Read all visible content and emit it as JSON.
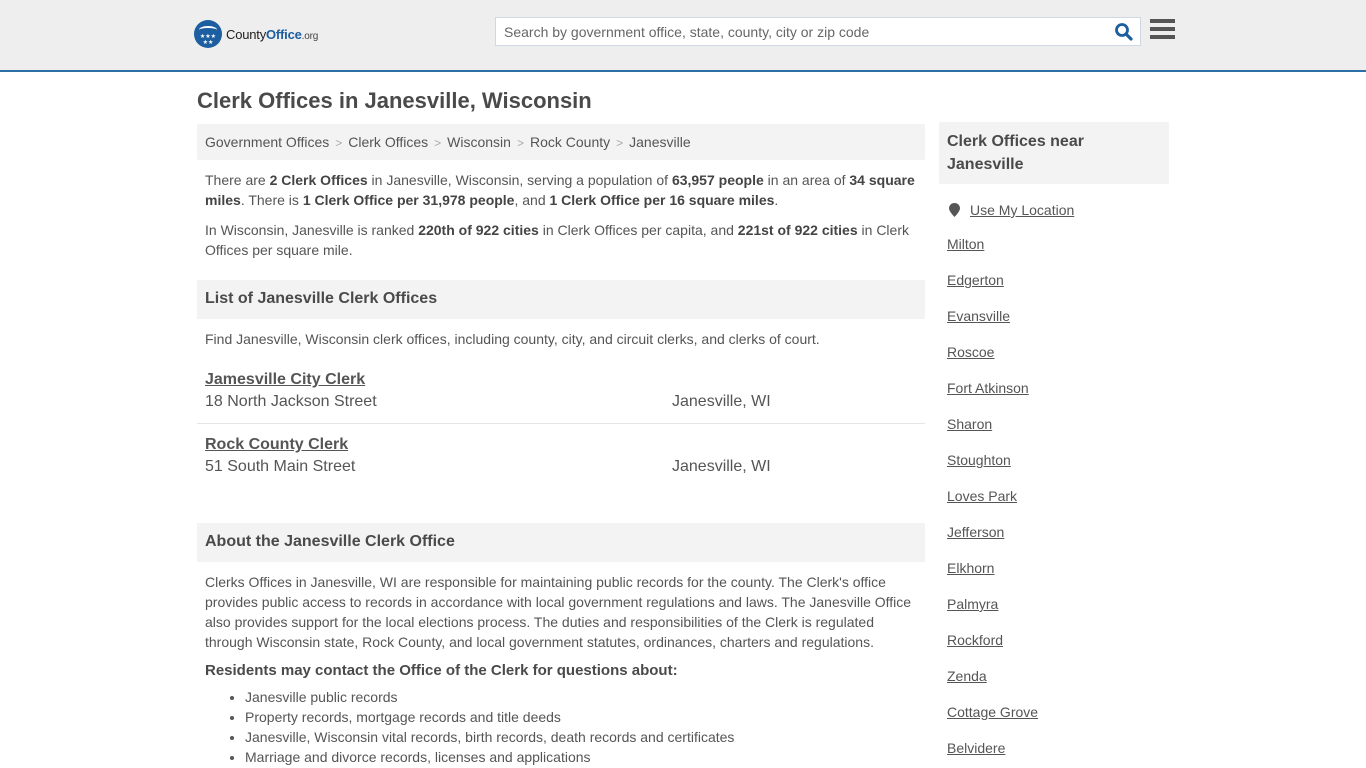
{
  "header": {
    "logo": {
      "brand_main": "County",
      "brand_accent": "Office",
      "brand_tld": ".org"
    },
    "search": {
      "placeholder": "Search by government office, state, county, city or zip code",
      "value": ""
    },
    "search_icon": "search-icon",
    "menu_icon": "hamburger-menu-icon",
    "accent_color": "#2f6fa7"
  },
  "page": {
    "title": "Clerk Offices in Janesville, Wisconsin"
  },
  "breadcrumb": [
    {
      "label": "Government Offices"
    },
    {
      "label": "Clerk Offices"
    },
    {
      "label": "Wisconsin"
    },
    {
      "label": "Rock County"
    },
    {
      "label": "Janesville"
    }
  ],
  "summary": {
    "p1": {
      "t1": "There are ",
      "b1": "2 Clerk Offices",
      "t2": " in Janesville, Wisconsin, serving a population of ",
      "b2": "63,957 people",
      "t3": " in an area of ",
      "b3": "34 square miles",
      "t4": ". There is ",
      "b4": "1 Clerk Office per 31,978 people",
      "t5": ", and ",
      "b5": "1 Clerk Office per 16 square miles",
      "t6": "."
    },
    "p2": {
      "t1": "In Wisconsin, Janesville is ranked ",
      "b1": "220th of 922 cities",
      "t2": " in Clerk Offices per capita, and ",
      "b2": "221st of 922 cities",
      "t3": " in Clerk Offices per square mile."
    }
  },
  "list_section": {
    "heading": "List of Janesville Clerk Offices",
    "intro": "Find Janesville, Wisconsin clerk offices, including county, city, and circuit clerks, and clerks of court.",
    "offices": [
      {
        "name": "Jamesville City Clerk",
        "address": "18 North Jackson Street",
        "city": "Janesville, WI"
      },
      {
        "name": "Rock County Clerk",
        "address": "51 South Main Street",
        "city": "Janesville, WI"
      }
    ]
  },
  "about_section": {
    "heading": "About the Janesville Clerk Office",
    "text": "Clerks Offices in Janesville, WI are responsible for maintaining public records for the county. The Clerk's office provides public access to records in accordance with local government regulations and laws. The Janesville Office also provides support for the local elections process. The duties and responsibilities of the Clerk is regulated through Wisconsin state, Rock County, and local government statutes, ordinances, charters and regulations.",
    "residents_heading": "Residents may contact the Office of the Clerk for questions about:",
    "items": [
      "Janesville public records",
      "Property records, mortgage records and title deeds",
      "Janesville, Wisconsin vital records, birth records, death records and certificates",
      "Marriage and divorce records, licenses and applications"
    ]
  },
  "sidebar": {
    "heading": "Clerk Offices near Janesville",
    "use_location": "Use My Location",
    "nearby": [
      "Milton",
      "Edgerton",
      "Evansville",
      "Roscoe",
      "Fort Atkinson",
      "Sharon",
      "Stoughton",
      "Loves Park",
      "Jefferson",
      "Elkhorn",
      "Palmyra",
      "Rockford",
      "Zenda",
      "Cottage Grove",
      "Belvidere"
    ]
  }
}
